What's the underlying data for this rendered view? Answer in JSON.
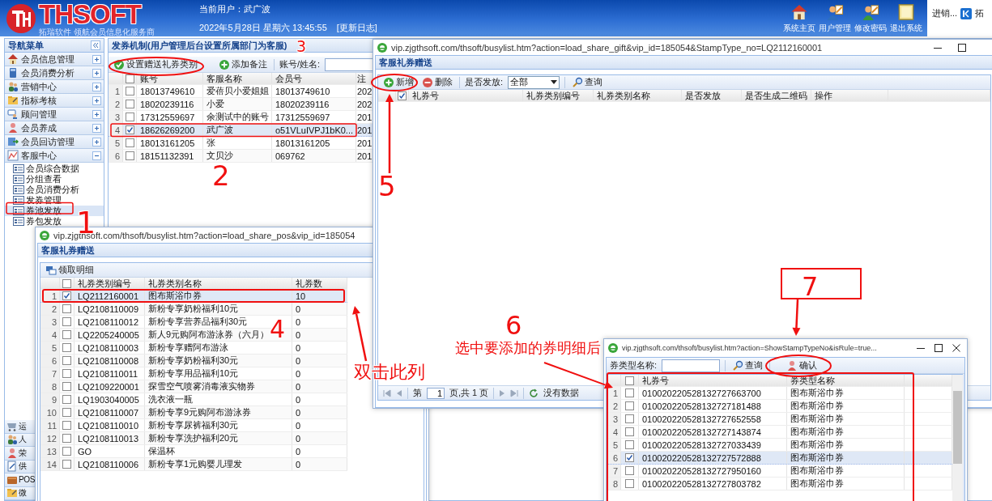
{
  "header": {
    "logo": "THSOFT",
    "logo_sub": "拓瑞软件  领航会员信息化服务商",
    "user": "当前用户：武广波",
    "datetime": "2022年5月28日 星期六 13:45:55",
    "update_log": "[更新日志]",
    "actions": [
      {
        "kind": "home",
        "label": "系统主页"
      },
      {
        "kind": "users",
        "label": "用户管理"
      },
      {
        "kind": "password",
        "label": "修改密码"
      },
      {
        "kind": "exit",
        "label": "退出系统"
      }
    ],
    "side_apps": [
      "进销...",
      "拓"
    ]
  },
  "sidebar": {
    "title": "导航菜单",
    "groups": [
      {
        "kind": "home",
        "label": "会员信息管理",
        "expanded": false
      },
      {
        "kind": "book",
        "label": "会员消费分析",
        "expanded": false
      },
      {
        "kind": "people",
        "label": "营销中心",
        "expanded": false
      },
      {
        "kind": "folder",
        "label": "指标考核",
        "expanded": false
      },
      {
        "kind": "chat",
        "label": "顾问管理",
        "expanded": false
      },
      {
        "kind": "person",
        "label": "会员养成",
        "expanded": false
      },
      {
        "kind": "door",
        "label": "会员回访管理",
        "expanded": false
      },
      {
        "kind": "chart",
        "label": "客服中心",
        "expanded": true,
        "children": [
          {
            "label": "会员综合数据",
            "selected": false
          },
          {
            "label": "分组查看",
            "selected": false
          },
          {
            "label": "会员消费分析",
            "selected": false
          },
          {
            "label": "发券管理",
            "selected": false
          },
          {
            "label": "券池发放",
            "selected": true
          },
          {
            "label": "券包发放",
            "selected": false
          }
        ]
      }
    ],
    "bottom_groups": [
      {
        "kind": "cart",
        "label": "运"
      },
      {
        "kind": "people",
        "label": "人"
      },
      {
        "kind": "person",
        "label": "荣"
      },
      {
        "kind": "doc",
        "label": "供"
      },
      {
        "kind": "pos",
        "label": "POS"
      },
      {
        "kind": "folder",
        "label": "微"
      }
    ]
  },
  "main": {
    "title": "发券机制(用户管理后台设置所属部门为客服)",
    "toolbar": [
      "设置赠送礼券类别",
      "添加备注"
    ],
    "search_label": "账号/姓名:",
    "header_checked": false,
    "columns": [
      "账号",
      "客服名称",
      "会员号",
      "注"
    ],
    "rows": [
      {
        "no": "1",
        "checked": false,
        "cells": [
          "18013749610",
          "爱蓓贝小爱姐姐",
          "18013749610",
          "202"
        ]
      },
      {
        "no": "2",
        "checked": false,
        "cells": [
          "18020239116",
          "小爱",
          "18020239116",
          "202"
        ]
      },
      {
        "no": "3",
        "checked": false,
        "cells": [
          "17312559697",
          "余测试中的账号",
          "17312559697",
          "201"
        ]
      },
      {
        "no": "4",
        "checked": true,
        "cells": [
          "18626269200",
          "武广波",
          "o51VLuIVPJ1bK0...",
          "201"
        ]
      },
      {
        "no": "5",
        "checked": false,
        "cells": [
          "18013161205",
          "张",
          "18013161205",
          "201"
        ]
      },
      {
        "no": "6",
        "checked": false,
        "cells": [
          "18151132391",
          "文贝沙",
          "069762",
          "201"
        ]
      }
    ]
  },
  "gift_window": {
    "url": "vip.zjgthsoft.com/thsoft/busylist.htm?action=load_share_gift&vip_id=185054&StampType_no=LQ2112160001",
    "title": "客服礼券赠送",
    "toolbar": [
      "新增",
      "删除"
    ],
    "filter_label": "是否发放:",
    "filter_value": "全部",
    "query": "查询",
    "all_checked": true,
    "columns": [
      "礼券号",
      "礼券类别编号",
      "礼券类别名称",
      "是否发放",
      "是否生成二维码",
      "操作"
    ],
    "pager": {
      "page_label": "第",
      "page": "1",
      "page_total": "页,共 1 页",
      "status": "没有数据"
    }
  },
  "pos_window": {
    "url": "vip.zjgthsoft.com/thsoft/busylist.htm?action=load_share_pos&vip_id=185054",
    "title": "客服礼券赠送",
    "toolbar": "领取明细",
    "header_checked": false,
    "columns": [
      "礼券类别编号",
      "礼券类别名称",
      "礼券数"
    ],
    "rows": [
      {
        "no": "1",
        "checked": true,
        "code": "LQ2112160001",
        "name": "图布斯浴巾券",
        "count": "10"
      },
      {
        "no": "2",
        "checked": false,
        "code": "LQ2108110009",
        "name": "新粉专享奶粉福利10元",
        "count": "0"
      },
      {
        "no": "3",
        "checked": false,
        "code": "LQ2108110012",
        "name": "新粉专享营养品福利30元",
        "count": "0"
      },
      {
        "no": "4",
        "checked": false,
        "code": "LQ2205240005",
        "name": "新人9元购阿布游泳券（六月）",
        "count": "0"
      },
      {
        "no": "5",
        "checked": false,
        "code": "LQ2108110003",
        "name": "新粉专享赠阿布游泳",
        "count": "0"
      },
      {
        "no": "6",
        "checked": false,
        "code": "LQ2108110008",
        "name": "新粉专享奶粉福利30元",
        "count": "0"
      },
      {
        "no": "7",
        "checked": false,
        "code": "LQ2108110011",
        "name": "新粉专享用品福利10元",
        "count": "0"
      },
      {
        "no": "8",
        "checked": false,
        "code": "LQ2109220001",
        "name": "探雪空气喷雾消毒液实物券",
        "count": "0"
      },
      {
        "no": "9",
        "checked": false,
        "code": "LQ1903040005",
        "name": "洗衣液一瓶",
        "count": "0"
      },
      {
        "no": "10",
        "checked": false,
        "code": "LQ2108110007",
        "name": "新粉专享9元购阿布游泳券",
        "count": "0"
      },
      {
        "no": "11",
        "checked": false,
        "code": "LQ2108110010",
        "name": "新粉专享尿裤福利30元",
        "count": "0"
      },
      {
        "no": "12",
        "checked": false,
        "code": "LQ2108110013",
        "name": "新粉专享洗护福利20元",
        "count": "0"
      },
      {
        "no": "13",
        "checked": false,
        "code": "GO",
        "name": "保温杯",
        "count": "0"
      },
      {
        "no": "14",
        "checked": false,
        "code": "LQ2108110006",
        "name": "新粉专享1元购婴儿理发",
        "count": "0"
      }
    ]
  },
  "stamp_window": {
    "url": "vip.zjgthsoft.com/thsoft/busylist.htm?action=ShowStampTypeNo&isRule=true...",
    "filter_label": "券类型名称:",
    "query": "查询",
    "confirm": "确认",
    "header_checked": false,
    "columns": [
      "礼券号",
      "券类型名称"
    ],
    "rows": [
      {
        "no": "1",
        "checked": false,
        "code": "010020220528132727663700",
        "name": "图布斯浴巾券"
      },
      {
        "no": "2",
        "checked": false,
        "code": "010020220528132727181488",
        "name": "图布斯浴巾券"
      },
      {
        "no": "3",
        "checked": false,
        "code": "010020220528132727652558",
        "name": "图布斯浴巾券"
      },
      {
        "no": "4",
        "checked": false,
        "code": "010020220528132727143874",
        "name": "图布斯浴巾券"
      },
      {
        "no": "5",
        "checked": false,
        "code": "010020220528132727033439",
        "name": "图布斯浴巾券"
      },
      {
        "no": "6",
        "checked": true,
        "code": "010020220528132727572888",
        "name": "图布斯浴巾券"
      },
      {
        "no": "7",
        "checked": false,
        "code": "010020220528132727950160",
        "name": "图布斯浴巾券"
      },
      {
        "no": "8",
        "checked": false,
        "code": "010020220528132727803782",
        "name": "图布斯浴巾券"
      }
    ]
  },
  "annotations": {
    "steps": [
      "1",
      "2",
      "3",
      "4",
      "5",
      "6",
      "7"
    ],
    "notes": [
      "双击此列",
      "选中要添加的券明细后"
    ]
  }
}
